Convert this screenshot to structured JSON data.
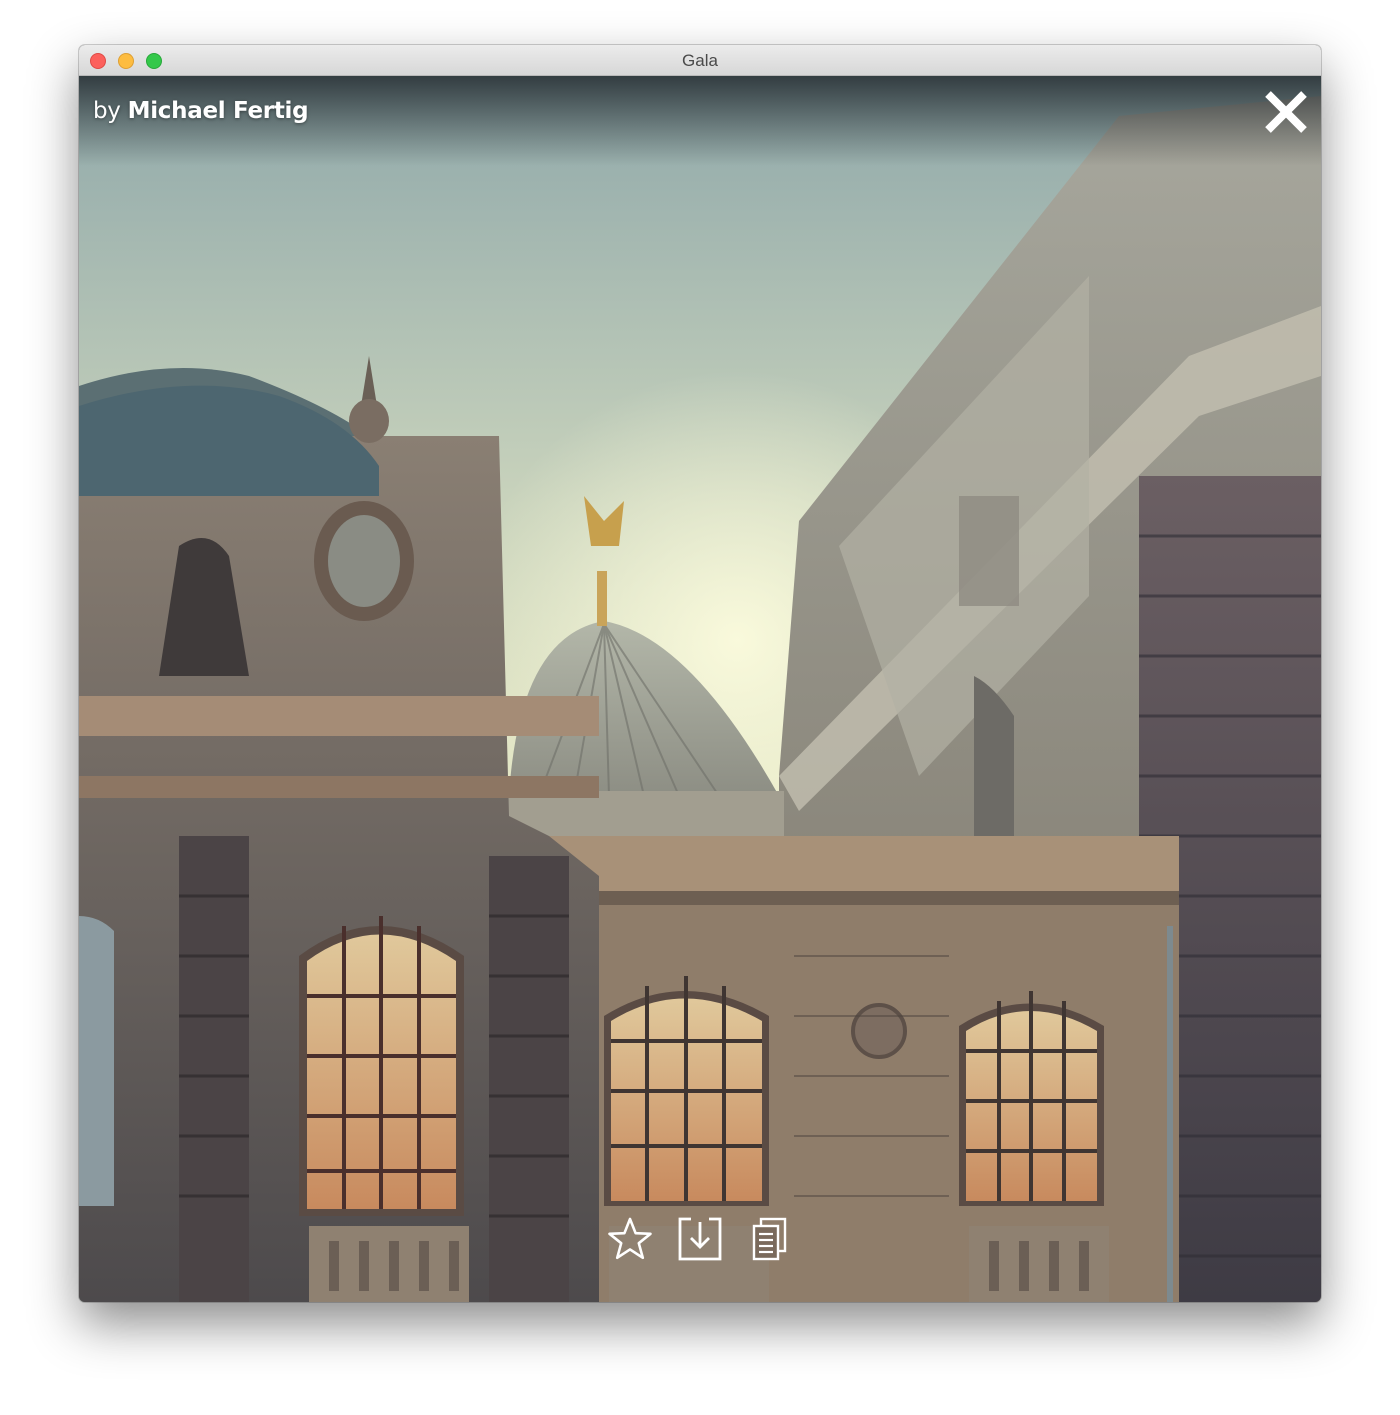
{
  "window": {
    "title": "Gala"
  },
  "photo": {
    "author_prefix": "by",
    "author_name": "Michael Fertig"
  },
  "icons": {
    "window_controls": [
      "close-window",
      "minimize-window",
      "maximize-window"
    ],
    "close": "close-icon",
    "actions": [
      "star-icon",
      "download-icon",
      "copy-icon"
    ]
  },
  "colors": {
    "window_close": "#fc605c",
    "window_minimize": "#fdbc40",
    "window_maximize": "#34c84a",
    "overlay_text": "#ffffff"
  }
}
